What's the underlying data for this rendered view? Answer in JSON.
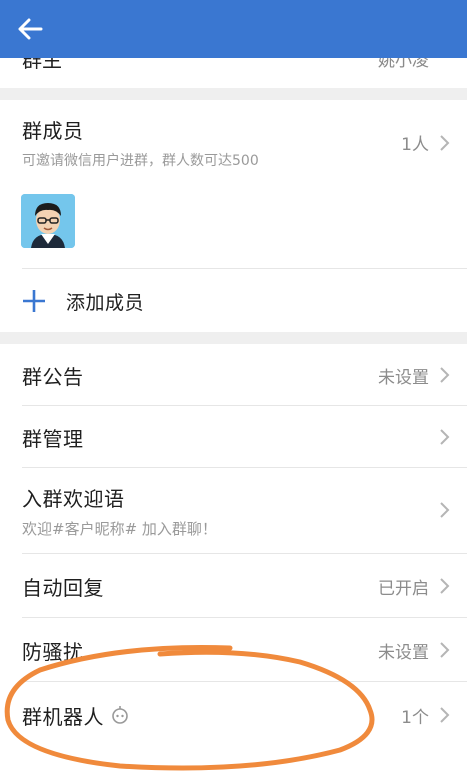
{
  "header": {
    "back_icon": "arrow-left-icon"
  },
  "cut_row": {
    "label": "群主",
    "value": "姚小凌"
  },
  "members": {
    "title": "群成员",
    "subtitle": "可邀请微信用户进群，群人数可达500",
    "count": "1人",
    "add_label": "添加成员"
  },
  "settings": [
    {
      "title": "群公告",
      "value": "未设置"
    },
    {
      "title": "群管理",
      "value": ""
    },
    {
      "title": "入群欢迎语",
      "sub": "欢迎#客户昵称# 加入群聊！",
      "value": ""
    },
    {
      "title": "自动回复",
      "value": "已开启"
    },
    {
      "title": "防骚扰",
      "value": "未设置"
    },
    {
      "title": "群机器人",
      "value": "1个"
    }
  ],
  "colors": {
    "header": "#3a77d1",
    "accent_plus": "#3a77d1",
    "annotation": "#f08a3c"
  }
}
